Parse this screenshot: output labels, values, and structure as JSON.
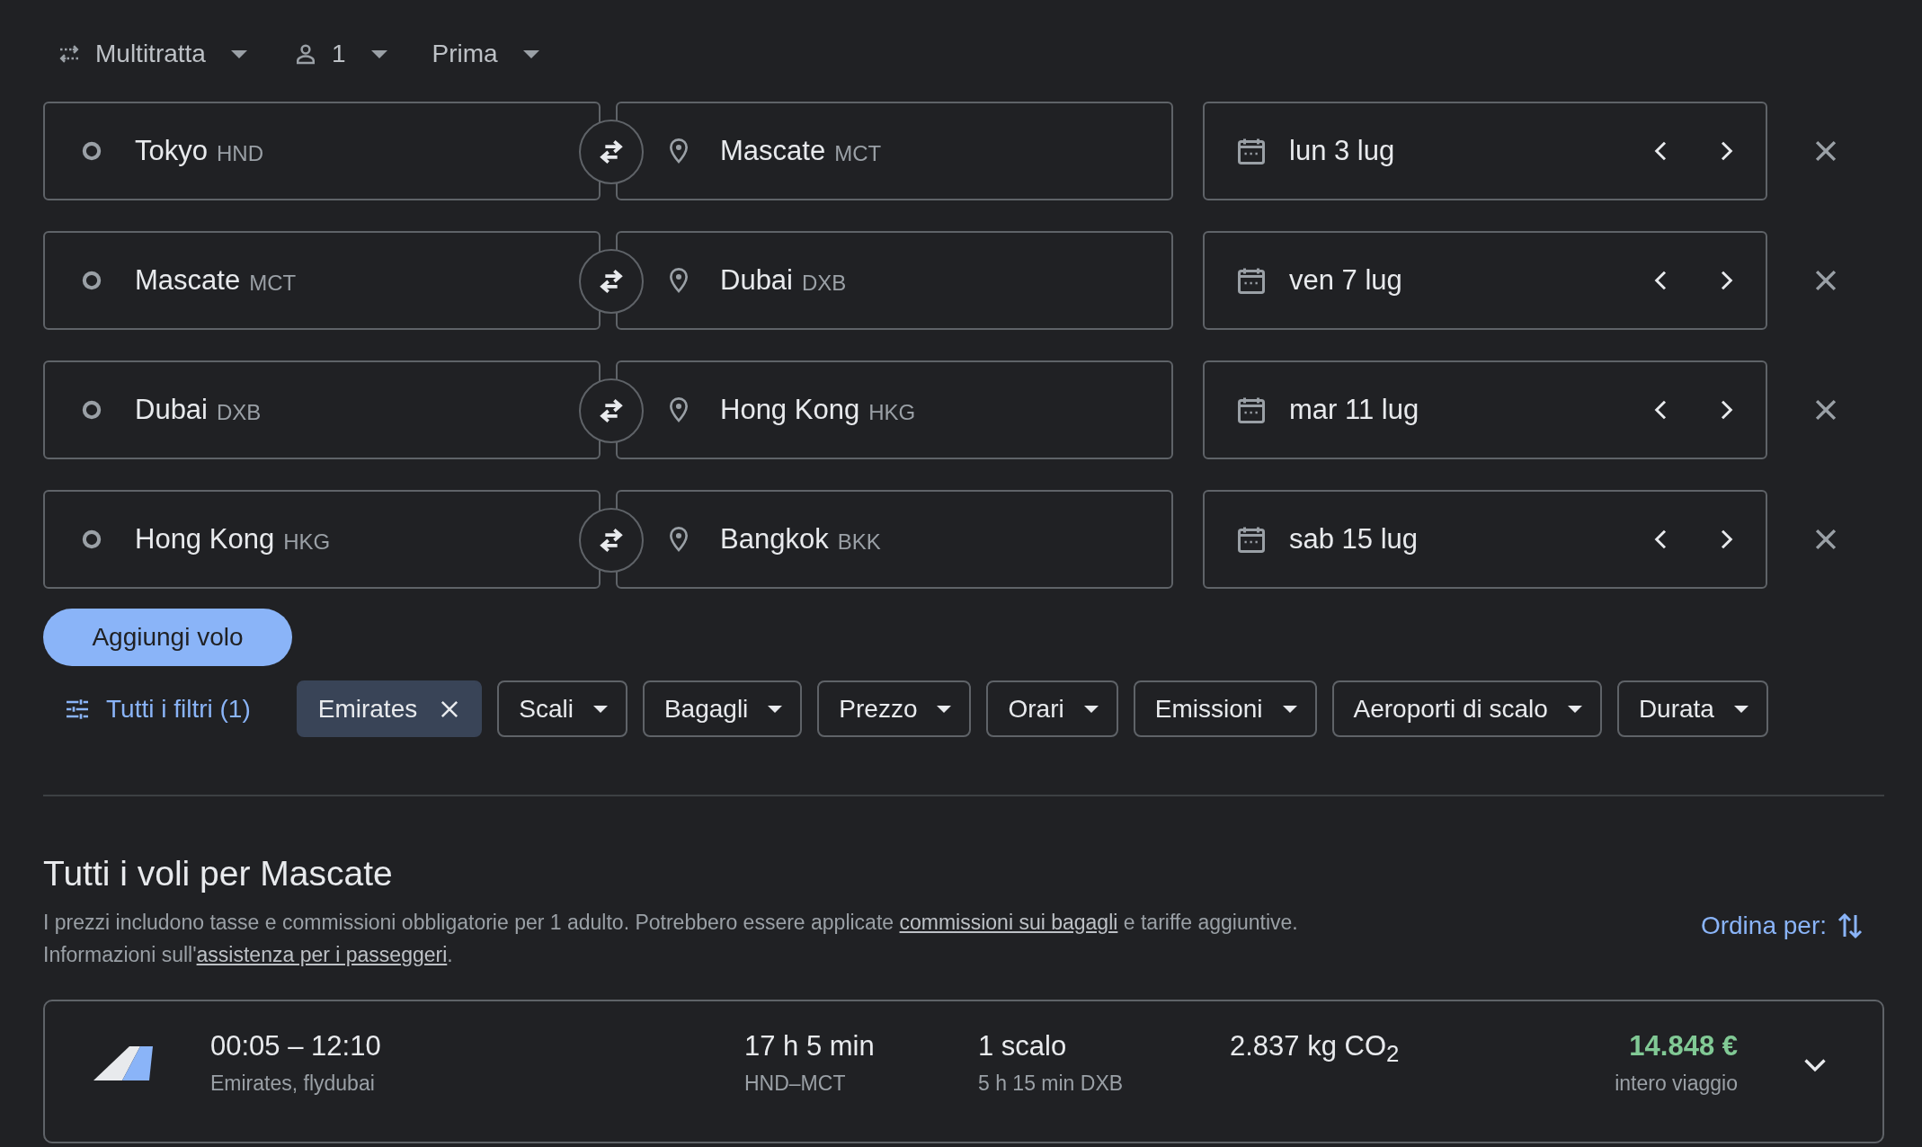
{
  "top_bar": [
    {
      "kind": "trip_type",
      "label": "Multitratta"
    },
    {
      "kind": "passengers",
      "label": "1"
    },
    {
      "kind": "cabin",
      "label": "Prima"
    }
  ],
  "legs": [
    {
      "origin": {
        "city": "Tokyo",
        "code": "HND"
      },
      "destination": {
        "city": "Mascate",
        "code": "MCT"
      },
      "date": "lun 3 lug"
    },
    {
      "origin": {
        "city": "Mascate",
        "code": "MCT"
      },
      "destination": {
        "city": "Dubai",
        "code": "DXB"
      },
      "date": "ven 7 lug"
    },
    {
      "origin": {
        "city": "Dubai",
        "code": "DXB"
      },
      "destination": {
        "city": "Hong Kong",
        "code": "HKG"
      },
      "date": "mar 11 lug"
    },
    {
      "origin": {
        "city": "Hong Kong",
        "code": "HKG"
      },
      "destination": {
        "city": "Bangkok",
        "code": "BKK"
      },
      "date": "sab 15 lug"
    }
  ],
  "add_button": "Aggiungi volo",
  "filters": [
    {
      "kind": "all",
      "label": "Tutti i filtri (1)"
    },
    {
      "kind": "active",
      "label": "Emirates"
    },
    {
      "kind": "dropdown",
      "label": "Scali"
    },
    {
      "kind": "dropdown",
      "label": "Bagagli"
    },
    {
      "kind": "dropdown",
      "label": "Prezzo"
    },
    {
      "kind": "dropdown",
      "label": "Orari"
    },
    {
      "kind": "dropdown",
      "label": "Emissioni"
    },
    {
      "kind": "dropdown",
      "label": "Aeroporti di scalo"
    },
    {
      "kind": "dropdown",
      "label": "Durata"
    }
  ],
  "results": {
    "title": "Tutti i voli per Mascate",
    "paragraphs": [
      [
        {
          "kind": "text",
          "text": "I prezzi includono tasse e commissioni obbligatorie per 1 adulto. Potrebbero essere applicate "
        },
        {
          "kind": "link",
          "text": "commissioni sui bagagli"
        },
        {
          "kind": "text",
          "text": " e tariffe aggiuntive."
        }
      ],
      [
        {
          "kind": "text",
          "text": "Informazioni sull'"
        },
        {
          "kind": "link",
          "text": "assistenza per i passeggeri"
        },
        {
          "kind": "text",
          "text": "."
        }
      ]
    ],
    "sort_label": "Ordina per:",
    "flights": [
      {
        "times": "00:05 – 12:10",
        "airlines": "Emirates, flydubai",
        "duration": "17 h 5 min",
        "route": "HND–MCT",
        "stops": "1 scalo",
        "layover": "5 h 15 min DXB",
        "emissions": "2.837 kg CO$_{2}$",
        "price": "14.848 €",
        "price_note": "intero viaggio"
      }
    ]
  }
}
